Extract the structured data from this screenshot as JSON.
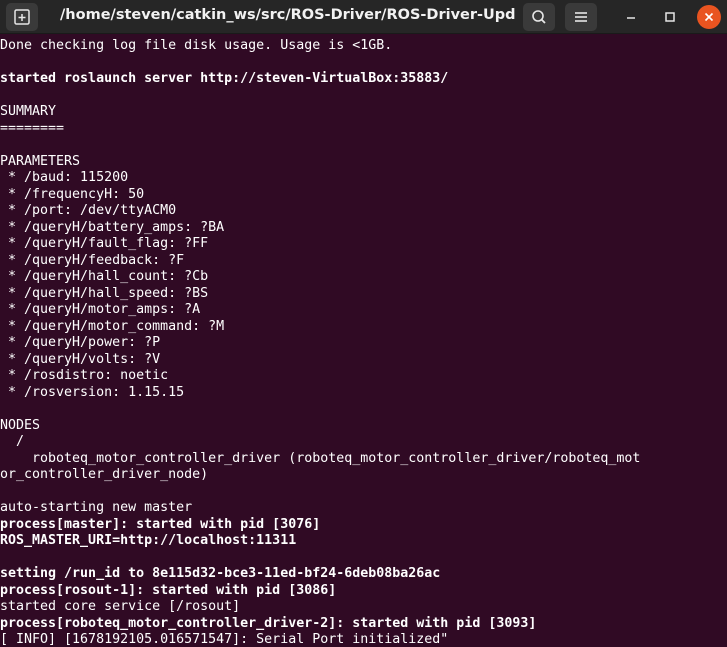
{
  "window": {
    "title": "/home/steven/catkin_ws/src/ROS-Driver/ROS-Driver-Update...",
    "icons": {
      "new_tab": "new-tab-icon",
      "search": "search-icon",
      "menu": "hamburger-menu-icon",
      "minimize": "minimize-icon",
      "maximize": "maximize-icon",
      "close": "close-icon"
    },
    "colors": {
      "terminal_bg": "#300a24",
      "titlebar_bg": "#262626",
      "close_button": "#e95420",
      "text": "#ffffff"
    }
  },
  "terminal": {
    "lines": [
      {
        "text": "Done checking log file disk usage. Usage is <1GB.",
        "bold": false
      },
      {
        "text": "",
        "bold": false
      },
      {
        "text": "started roslaunch server http://steven-VirtualBox:35883/",
        "bold": true
      },
      {
        "text": "",
        "bold": false
      },
      {
        "text": "SUMMARY",
        "bold": false
      },
      {
        "text": "========",
        "bold": false
      },
      {
        "text": "",
        "bold": false
      },
      {
        "text": "PARAMETERS",
        "bold": false
      },
      {
        "text": " * /baud: 115200",
        "bold": false
      },
      {
        "text": " * /frequencyH: 50",
        "bold": false
      },
      {
        "text": " * /port: /dev/ttyACM0",
        "bold": false
      },
      {
        "text": " * /queryH/battery_amps: ?BA",
        "bold": false
      },
      {
        "text": " * /queryH/fault_flag: ?FF",
        "bold": false
      },
      {
        "text": " * /queryH/feedback: ?F",
        "bold": false
      },
      {
        "text": " * /queryH/hall_count: ?Cb",
        "bold": false
      },
      {
        "text": " * /queryH/hall_speed: ?BS",
        "bold": false
      },
      {
        "text": " * /queryH/motor_amps: ?A",
        "bold": false
      },
      {
        "text": " * /queryH/motor_command: ?M",
        "bold": false
      },
      {
        "text": " * /queryH/power: ?P",
        "bold": false
      },
      {
        "text": " * /queryH/volts: ?V",
        "bold": false
      },
      {
        "text": " * /rosdistro: noetic",
        "bold": false
      },
      {
        "text": " * /rosversion: 1.15.15",
        "bold": false
      },
      {
        "text": "",
        "bold": false
      },
      {
        "text": "NODES",
        "bold": false
      },
      {
        "text": "  /",
        "bold": false
      },
      {
        "text": "    roboteq_motor_controller_driver (roboteq_motor_controller_driver/roboteq_mot",
        "bold": false
      },
      {
        "text": "or_controller_driver_node)",
        "bold": false
      },
      {
        "text": "",
        "bold": false
      },
      {
        "text": "auto-starting new master",
        "bold": false
      },
      {
        "text": "process[master]: started with pid [3076]",
        "bold": true
      },
      {
        "text": "ROS_MASTER_URI=http://localhost:11311",
        "bold": true
      },
      {
        "text": "",
        "bold": false
      },
      {
        "text": "setting /run_id to 8e115d32-bce3-11ed-bf24-6deb08ba26ac",
        "bold": true
      },
      {
        "text": "process[rosout-1]: started with pid [3086]",
        "bold": true
      },
      {
        "text": "started core service [/rosout]",
        "bold": false
      },
      {
        "text": "process[roboteq_motor_controller_driver-2]: started with pid [3093]",
        "bold": true
      },
      {
        "text": "[ INFO] [1678192105.016571547]: Serial Port initialized\"",
        "bold": false
      }
    ]
  }
}
